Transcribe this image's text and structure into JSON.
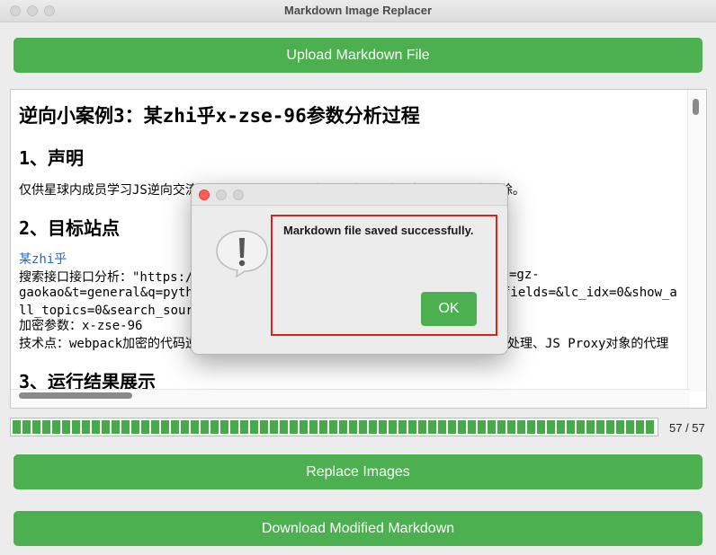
{
  "window": {
    "title": "Markdown Image Replacer"
  },
  "buttons": {
    "upload": "Upload Markdown File",
    "replace": "Replace Images",
    "download": "Download Modified Markdown"
  },
  "editor": {
    "h1": "逆向小案例3：某zhi乎x-zse-96参数分析过程",
    "h2_1": "1、声明",
    "p_declaration": "仅供星球内成员学习JS逆向交流使用，不得用于任何商业用途，如有侵权，联系作者删除。",
    "h2_2": "2、目标站点",
    "link_site": "某zhi乎",
    "p_search_a": "搜索接口接口分析：\"https:/",
    "p_search_b": "=gz-",
    "p_search_c": "gaokao&t=general&q=pyth",
    "p_search_d": "fields=&lc_idx=0&show_a",
    "p_search_e": "ll_topics=0&search_sour",
    "p_param": "加密参数：x-zse-96",
    "p_tech_a": "技术点：webpack加密的代码逆",
    "p_tech_b": "处理、JS Proxy对象的代理",
    "h2_3": "3、运行结果展示"
  },
  "progress": {
    "current": 57,
    "total": 57,
    "text": "57 / 57",
    "fraction": 1.0
  },
  "dialog": {
    "message": "Markdown file saved successfully.",
    "ok_label": "OK",
    "icon": "exclamation-alert-icon"
  },
  "colors": {
    "accent": "#4caf50",
    "highlight": "#e01e1e",
    "link": "#1a6ad6"
  }
}
